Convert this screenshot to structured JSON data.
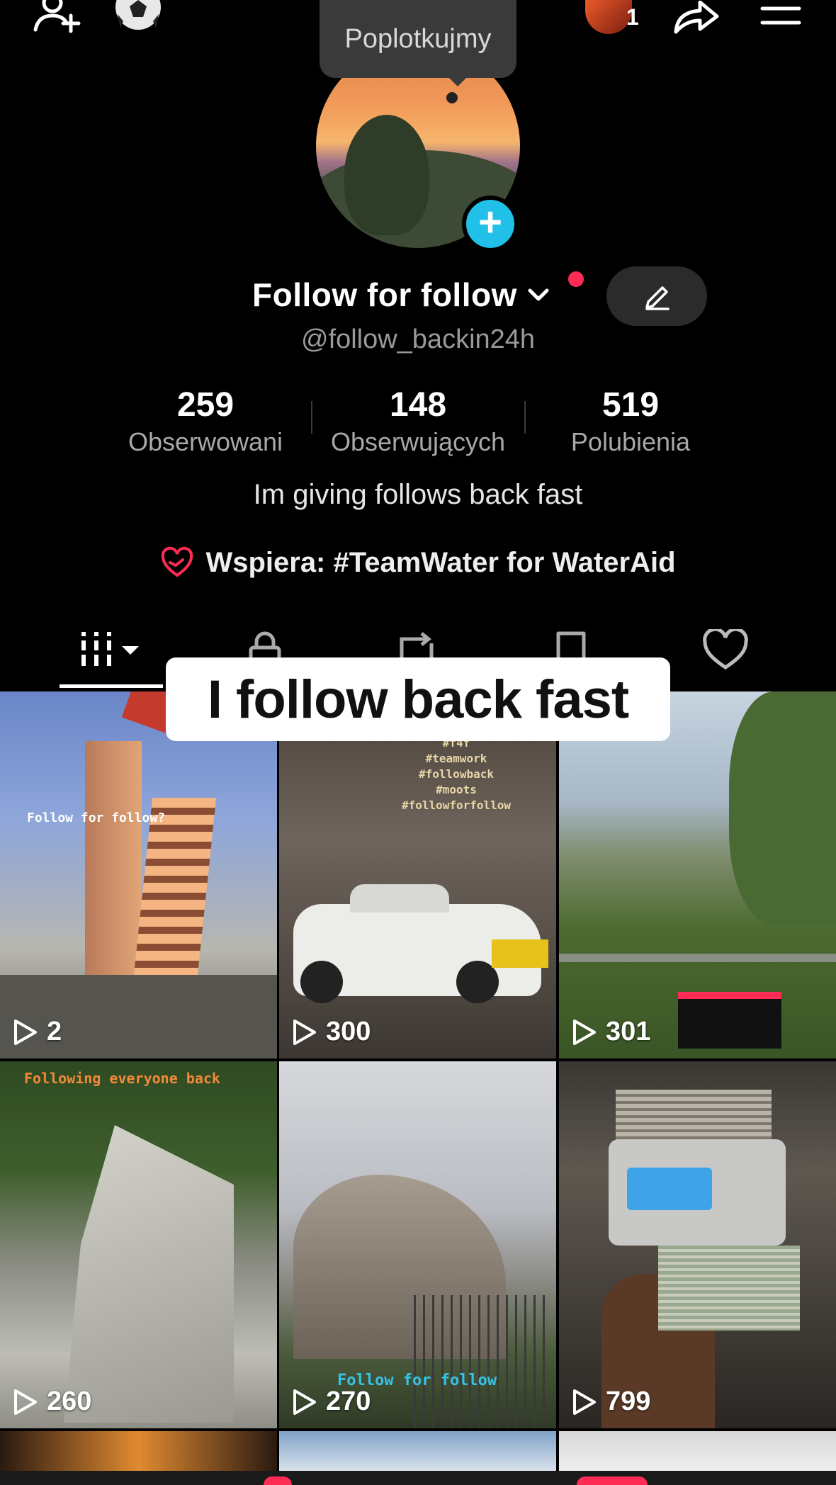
{
  "top_bar": {
    "add_friend_icon": "person-plus-icon",
    "ball_icon": "soccer-ball-icon",
    "notification_count": "1",
    "share_icon": "share-arrow-icon",
    "menu_icon": "hamburger-menu-icon"
  },
  "tooltip": {
    "text": "Poplotkujmy"
  },
  "profile": {
    "display_name": "Follow for follow",
    "username": "@follow_backin24h",
    "stats": [
      {
        "value": "259",
        "label": "Obserwowani"
      },
      {
        "value": "148",
        "label": "Obserwujących"
      },
      {
        "value": "519",
        "label": "Polubienia"
      }
    ],
    "bio": "Im giving follows back fast",
    "support": "Wspiera: #TeamWater for WaterAid"
  },
  "tabs": [
    {
      "icon": "grid-videos-icon",
      "active": true
    },
    {
      "icon": "lock-icon",
      "active": false
    },
    {
      "icon": "repost-icon",
      "active": false
    },
    {
      "icon": "bookmark-icon",
      "active": false
    },
    {
      "icon": "heart-outline-icon",
      "active": false
    }
  ],
  "caption": {
    "text": "I follow back fast"
  },
  "videos": [
    {
      "views": "2",
      "overlay": "Follow for follow?"
    },
    {
      "views": "300",
      "overlay": "#f4f\n#teamwork\n#followback\n#moots\n#followforfollow"
    },
    {
      "views": "301",
      "overlay": ""
    },
    {
      "views": "260",
      "overlay": "Following everyone back"
    },
    {
      "views": "270",
      "overlay": "Follow for follow"
    },
    {
      "views": "799",
      "overlay": ""
    }
  ],
  "colors": {
    "accent_red": "#fe2c55",
    "accent_cyan": "#20c0e8",
    "background": "#000000"
  }
}
